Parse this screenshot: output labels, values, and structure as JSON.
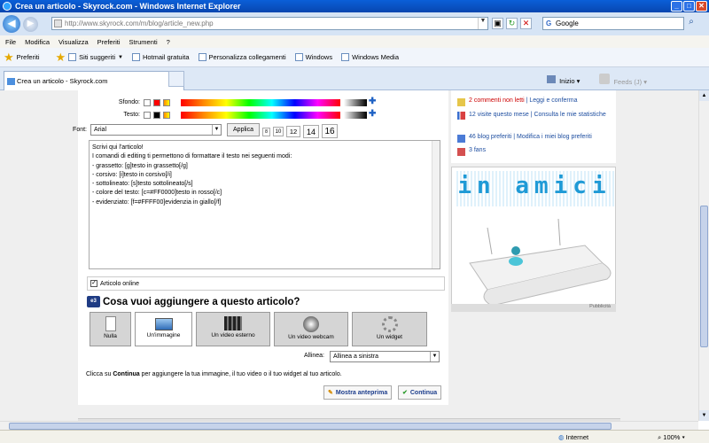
{
  "window": {
    "title": "Crea un articolo - Skyrock.com - Windows Internet Explorer"
  },
  "address": {
    "url": "http://www.skyrock.com/m/blog/article_new.php",
    "search_value": "Google"
  },
  "menu": [
    "File",
    "Modifica",
    "Visualizza",
    "Preferiti",
    "Strumenti",
    "?"
  ],
  "favorites": {
    "label": "Preferiti",
    "items": [
      "Siti suggeriti",
      "Hotmail gratuita",
      "Personalizza collegamenti",
      "Windows",
      "Windows Media"
    ]
  },
  "tab": {
    "title": "Crea un articolo - Skyrock.com",
    "home_label": "Inizio",
    "feeds_label": "Feeds (J)"
  },
  "editor": {
    "sfondo_label": "Sfondo:",
    "testo_label": "Testo:",
    "font_label": "Font:",
    "font_value": "Arial",
    "apply_label": "Applica",
    "sizes": [
      "8",
      "10",
      "12",
      "14",
      "16"
    ],
    "lines": [
      "Scrivi qui l'articolo!",
      "",
      "I comandi di editing ti permettono di formattare il testo nei seguenti modi:",
      "- grassetto: [g]testo in grassetto[/g]",
      "- corsivo: [i]testo in corsivo[/i]",
      "- sottolineato: [s]testo sottolineato[/s]",
      "- colore del testo: [c=#FF0000]testo in rosso[/c]",
      "- evidenziato: [f=#FFFF00]evidenzia in giallo[/f]"
    ],
    "online_label": "Articolo online"
  },
  "attach": {
    "heading": "Cosa vuoi aggiungere a questo articolo?",
    "badge": "e3",
    "options": [
      "Nulla",
      "Un'immagine",
      "Un video esterno",
      "Un video webcam",
      "Un widget"
    ],
    "align_label": "Allinea:",
    "align_value": "Allinea a sinistra",
    "hint_pre": "Clicca su ",
    "hint_bold": "Continua",
    "hint_post": " per aggiungere la tua immagine, il tuo video o il tuo widget al tuo articolo.",
    "preview_label": "Mostra anteprima",
    "continue_label": "Continua"
  },
  "sidebar": {
    "comments_count": "2 commenti non letti",
    "comments_link": "Leggi e conferma",
    "visits_count": "12",
    "visits_text": " visite questo mese",
    "visits_link": "Consulta le mie statistiche",
    "fav_count": "46",
    "fav_text": " blog preferiti",
    "fav_link": "Modifica i miei blog preferiti",
    "fans": "3 fans"
  },
  "ad": {
    "title": "in amici",
    "label": "Pubblicità"
  },
  "status": {
    "zone": "Internet",
    "zoom": "100%"
  },
  "colors": {
    "titlebar": "#0846b0",
    "link": "#1e4ea0",
    "alert": "#cc0000"
  }
}
